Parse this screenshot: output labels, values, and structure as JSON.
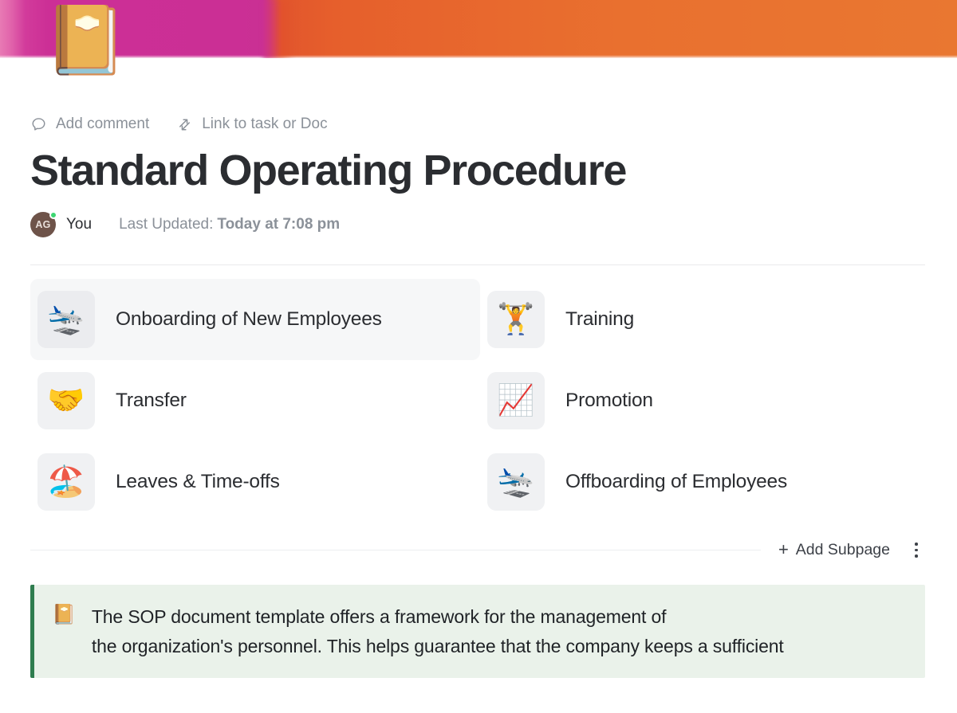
{
  "banner": {
    "colors": {
      "pink_light": "#e87ab4",
      "pink": "#cb2f95",
      "orange": "#e9702f"
    }
  },
  "doc": {
    "icon": "📔",
    "icon_name": "notebook-with-decorative-cover",
    "title": "Standard Operating Procedure"
  },
  "meta_actions": [
    {
      "label": "Add comment",
      "icon": "comment-icon"
    },
    {
      "label": "Link to task or Doc",
      "icon": "link-transfer-icon"
    }
  ],
  "byline": {
    "avatar_initials": "AG",
    "avatar_color": "#6e5349",
    "status_color": "#3dd672",
    "author": "You",
    "updated_label": "Last Updated:",
    "updated_value": "Today at 7:08 pm"
  },
  "subpages": [
    {
      "icon": "🛬",
      "icon_name": "airplane-arrival-emoji",
      "label": "Onboarding of New Employees",
      "hover": true
    },
    {
      "icon": "🏋️",
      "icon_name": "person-lifting-weights-emoji",
      "label": "Training",
      "hover": false
    },
    {
      "icon": "🤝",
      "icon_name": "handshake-emoji",
      "label": "Transfer",
      "hover": false
    },
    {
      "icon": "📈",
      "icon_name": "chart-increasing-emoji",
      "label": "Promotion",
      "hover": false
    },
    {
      "icon": "🏖️",
      "icon_name": "beach-with-umbrella-emoji",
      "label": "Leaves & Time-offs",
      "hover": false
    },
    {
      "icon": "🛬",
      "icon_name": "airplane-arrival-emoji",
      "label": "Offboarding of Employees",
      "hover": false
    }
  ],
  "footer": {
    "add_subpage_plus": "+",
    "add_subpage_label": "Add Subpage",
    "menu_icon": "kebab-menu-icon"
  },
  "callout": {
    "icon": "📔",
    "icon_name": "notebook-emoji",
    "accent_color": "#2f7d4f",
    "background_color": "#eaf2ea",
    "line1": "The SOP document template offers a framework for the management of",
    "line2": "the organization's personnel. This helps guarantee that the company keeps a sufficient"
  }
}
